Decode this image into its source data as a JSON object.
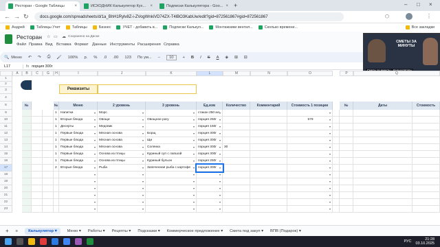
{
  "browser": {
    "tabs": [
      {
        "label": "Ресторан - Google Таблицы",
        "active": true
      },
      {
        "label": "ИСХОДНИК Калькулятор Кух...",
        "active": false
      },
      {
        "label": "Подписки Калькулятора - Goo...",
        "active": false
      }
    ],
    "url": "docs.google.com/spreadsheets/d/1a_BhH1Rylv8Z-i-ZVogWnkiVD74ZX-T4lBO3KabUw/edit?gid=872561867#gid=872561867",
    "bookmarks": [
      "Андрей",
      "Таблицы Учет",
      "Таблицы",
      "Бизнес",
      "УЧЕТ - добавить в...",
      "Подписки Калькул...",
      "Монтажники вентил...",
      "Сколько времени..."
    ],
    "all_bookmarks": "Все закладки"
  },
  "app": {
    "title": "Ресторан",
    "saved_status": "Сохранено на Диске",
    "menus": [
      "Файл",
      "Правка",
      "Вид",
      "Вставка",
      "Формат",
      "Данные",
      "Инструменты",
      "Расширения",
      "Справка"
    ],
    "toolbar": {
      "menus_label": "Меню",
      "zoom": "100%",
      "currency": "р.",
      "percent": "%",
      "decimals_dec": ".0",
      "decimals_inc": ".00",
      "number_format": "123",
      "font": "По ум...",
      "font_size": "10"
    },
    "cell_ref": "L17",
    "formula": "порция 300г"
  },
  "video": {
    "title": "СМЕТЫ ЗА МИНУТЫ",
    "caption": "Сметы за минуты - Калькуляторы"
  },
  "sheet": {
    "section_title": "Реквизиты",
    "column_letters": [
      "A",
      "B",
      "C",
      "G",
      "H",
      "I",
      "J",
      "K",
      "L",
      "M",
      "N",
      "O",
      "P",
      "Q"
    ],
    "headers": [
      "№",
      "№",
      "Меню",
      "2 уровень",
      "3 уровень",
      "Ед.изм",
      "Количество",
      "Комментарий",
      "Стоимость 1 позиции",
      "№",
      "Даты",
      "Стоимость"
    ],
    "row_numbers": [
      "1",
      "2",
      "3",
      "4",
      "8",
      "9",
      "10",
      "11",
      "12",
      "13",
      "14",
      "15",
      "16",
      "17",
      "18",
      "19",
      "20",
      "21",
      "22",
      "23"
    ],
    "rows": [
      {
        "num": "1",
        "menu": "Напитки",
        "level2": "Морс",
        "level3": "",
        "unit": "стакан 250 мл",
        "qty": "",
        "comment": "",
        "cost": ""
      },
      {
        "num": "1",
        "menu": "Вторые блюда",
        "level2": "Овощи",
        "level3": "Овощное рагу",
        "unit": "порция 250г",
        "qty": "",
        "comment": "",
        "cost": "579"
      },
      {
        "num": "1",
        "menu": "Десерты",
        "level2": "Медовик",
        "level3": "",
        "unit": "порция 150г",
        "qty": "",
        "comment": "",
        "cost": ""
      },
      {
        "num": "1",
        "menu": "Первые блюда",
        "level2": "Мясная основа",
        "level3": "Борщ",
        "unit": "порция 300г",
        "qty": "",
        "comment": "",
        "cost": ""
      },
      {
        "num": "1",
        "menu": "Первые блюда",
        "level2": "Мясная основа",
        "level3": "Щи",
        "unit": "порция 300г",
        "qty": "",
        "comment": "",
        "cost": ""
      },
      {
        "num": "1",
        "menu": "Первые блюда",
        "level2": "Мясная основа",
        "level3": "Солянка",
        "unit": "порция 300г",
        "qty": "30",
        "comment": "",
        "cost": ""
      },
      {
        "num": "1",
        "menu": "Первые блюда",
        "level2": "Основа из птицы",
        "level3": "Куриный суп с лапшой",
        "unit": "порция 300г",
        "qty": "",
        "comment": "",
        "cost": ""
      },
      {
        "num": "1",
        "menu": "Первые блюда",
        "level2": "Основа из птицы",
        "level3": "Куриный бульон",
        "unit": "порция 250г",
        "qty": "",
        "comment": "",
        "cost": ""
      },
      {
        "num": "2",
        "menu": "Вторые блюда",
        "level2": "Рыба",
        "level3": "Запеченная рыба с картофе",
        "unit": "порция 300г",
        "qty": "",
        "comment": "",
        "cost": ""
      }
    ],
    "tabs": [
      "Калькулятор",
      "Меню",
      "Работы",
      "Рецепты",
      "Подсказки",
      "Коммерческое предложение",
      "Смета под закуп",
      "ВПВ (Подарок)"
    ],
    "active_tab": "Калькулятор"
  },
  "taskbar": {
    "time": "21:28",
    "date": "03.10.2025",
    "lang": "РУС"
  },
  "colors": {
    "accent_green": "#1e8e3e",
    "header_bg": "#dfe7f1",
    "rekvizity_border": "#e8c547",
    "rekvizity_bg": "#fbf3d1"
  }
}
